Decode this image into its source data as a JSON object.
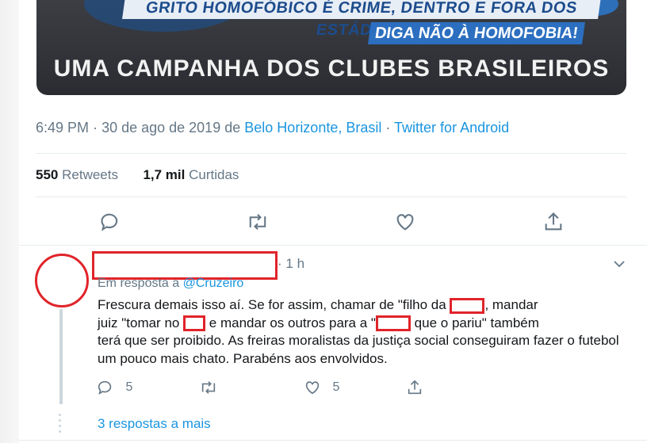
{
  "banner": {
    "line1": "GRITO HOMOFÓBICO É CRIME, DENTRO E FORA DOS ESTÁDIOS",
    "line2": "DIGA NÃO À HOMOFOBIA!",
    "line3": "UMA CAMPANHA DOS CLUBES BRASILEIROS"
  },
  "tweet": {
    "time": "6:49 PM",
    "date": "30 de ago de 2019",
    "from_label": "de",
    "location": "Belo Horizonte, Brasil",
    "client": "Twitter for Android",
    "retweets_count": "550",
    "retweets_label": "Retweets",
    "likes_count": "1,7 mil",
    "likes_label": "Curtidas"
  },
  "reply": {
    "time": "1 h",
    "in_reply_label": "Em resposta a",
    "in_reply_handle": "@Cruzeiro",
    "text_1": "Frescura demais isso aí. Se for assim, chamar de \"filho da ",
    "text_2": ", mandar",
    "text_3": "juiz \"tomar no ",
    "text_4": " e mandar os outros para a \"",
    "text_5": " que o pariu\" também",
    "text_6": "terá que ser proibido. As freiras moralistas da justiça social conseguiram fazer o futebol um pouco mais chato. Parabéns aos envolvidos.",
    "reply_count": "5",
    "like_count": "5",
    "more_replies": "3 respostas a mais"
  },
  "icons": [
    "reply-icon",
    "retweet-icon",
    "like-icon",
    "share-icon",
    "chevron-down-icon"
  ],
  "colors": {
    "link": "#1b95e0",
    "muted": "#657786",
    "annotation_red": "#e0242a",
    "banner_blue": "#2c6fc0"
  }
}
